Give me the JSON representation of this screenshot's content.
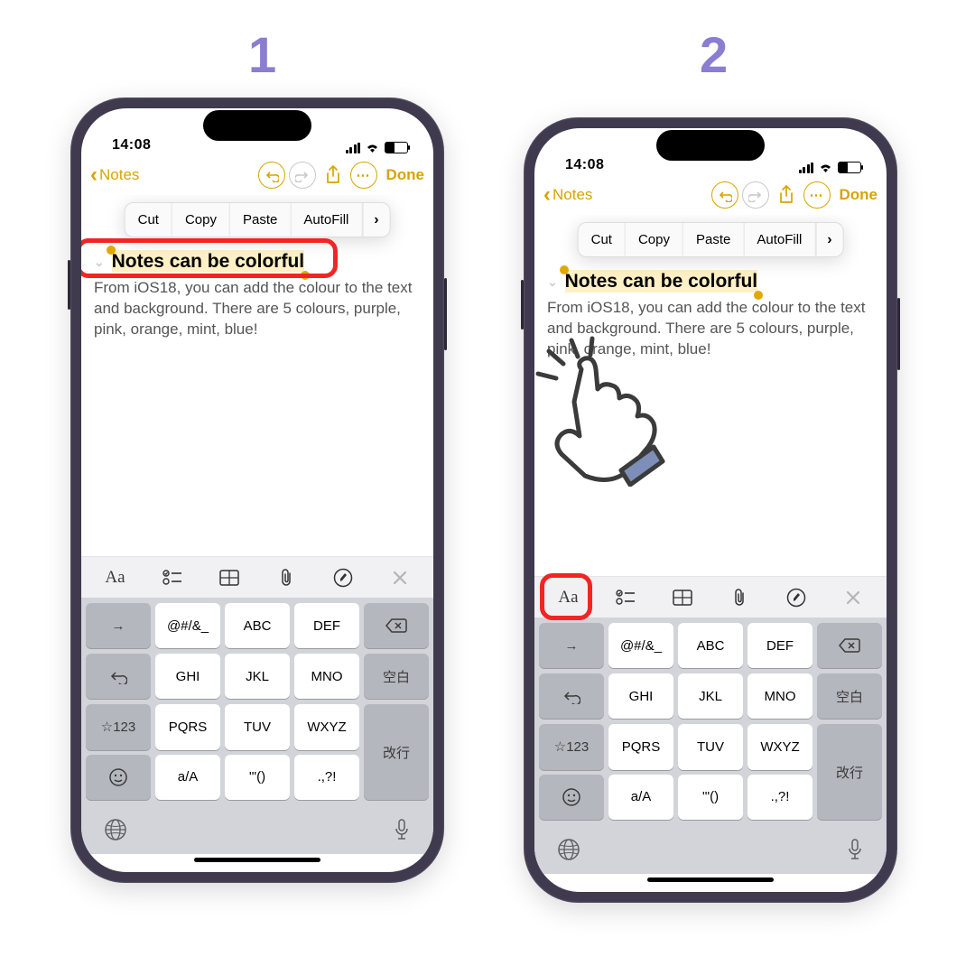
{
  "steps": {
    "label1": "1",
    "label2": "2"
  },
  "status": {
    "time": "14:08"
  },
  "nav": {
    "back": "Notes",
    "done": "Done"
  },
  "contextMenu": {
    "items": [
      "Cut",
      "Copy",
      "Paste",
      "AutoFill"
    ]
  },
  "note": {
    "title": "Notes can be colorful",
    "body": "From iOS18, you can add the colour to the text and background. There are 5 colours, purple, pink, orange, mint, blue!"
  },
  "formatBar": {
    "aa": "Aa"
  },
  "keyboard": {
    "row1": [
      "@#/&_",
      "ABC",
      "DEF"
    ],
    "row2": [
      "GHI",
      "JKL",
      "MNO"
    ],
    "row3": [
      "PQRS",
      "TUV",
      "WXYZ"
    ],
    "row4": [
      "a/A",
      "'\"()",
      ".,?!"
    ],
    "side": {
      "arrow": "→",
      "star": "☆123",
      "space": "空白",
      "return": "改行"
    }
  }
}
